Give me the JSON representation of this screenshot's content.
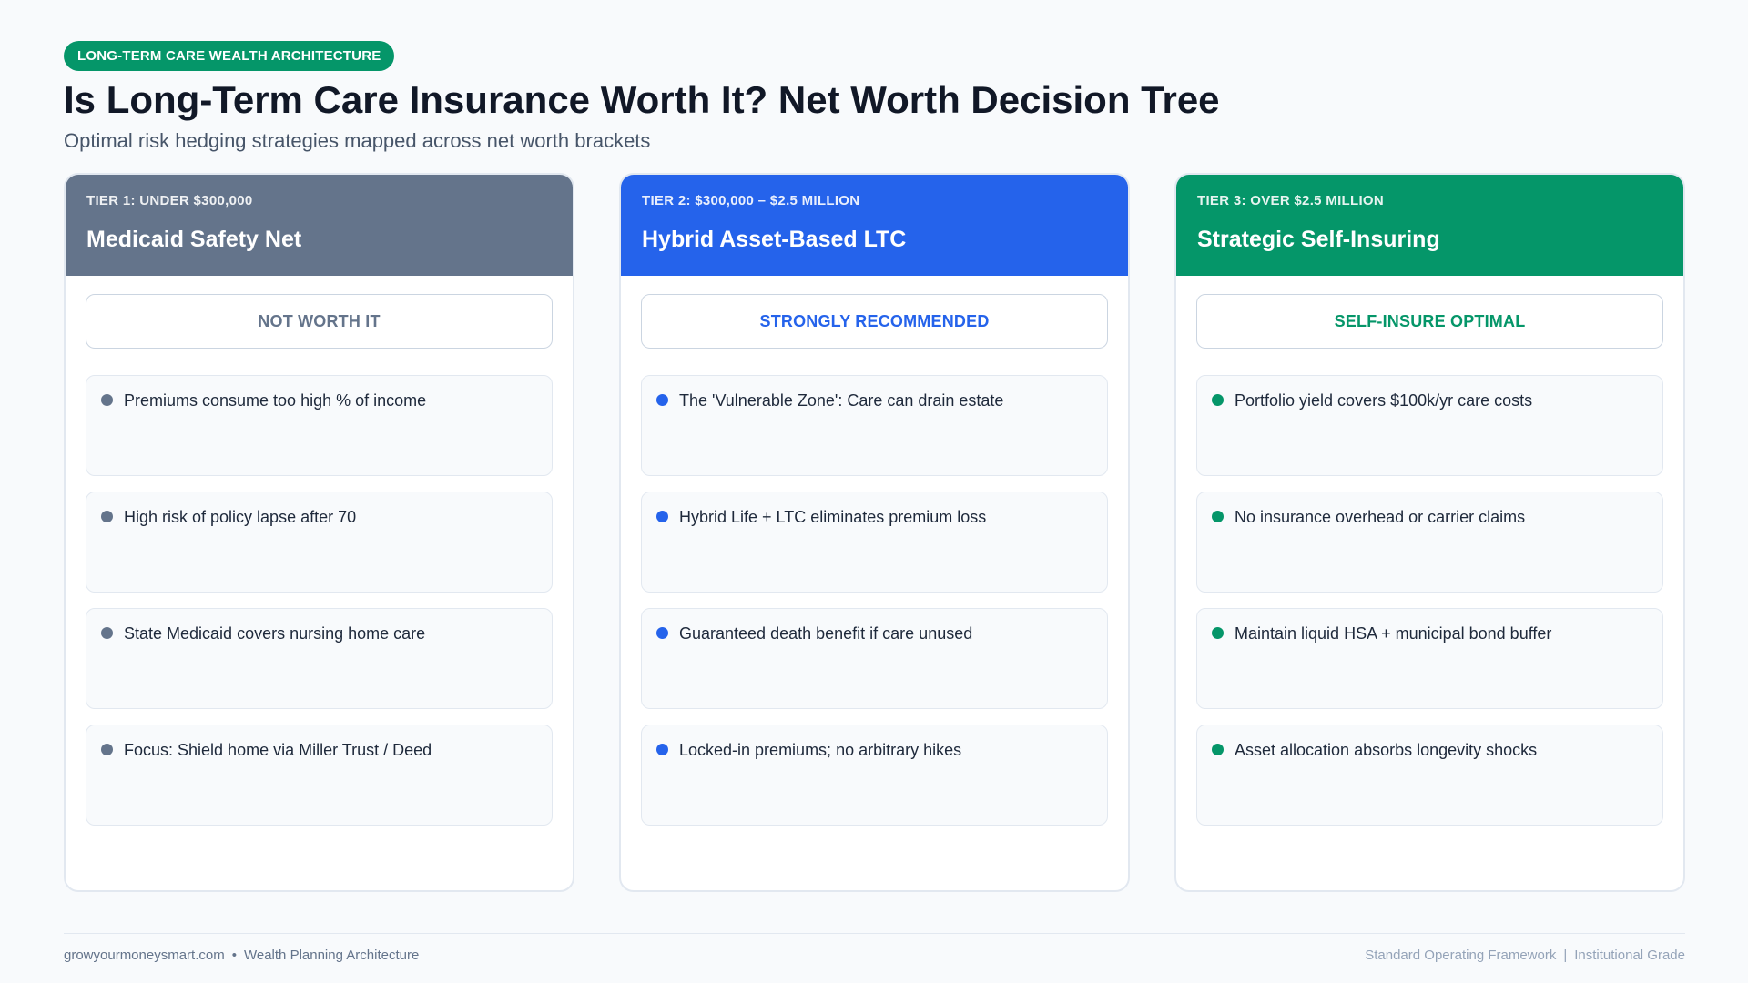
{
  "header": {
    "badge": "LONG-TERM CARE WEALTH ARCHITECTURE",
    "title": "Is Long-Term Care Insurance Worth It? Net Worth Decision Tree",
    "subtitle": "Optimal risk hedging strategies mapped across net worth brackets"
  },
  "colors": {
    "badge": "#059669",
    "tier1": "#64748b",
    "tier2": "#2563eb",
    "tier3": "#059669"
  },
  "tiers": [
    {
      "label": "TIER 1: UNDER $300,000",
      "name": "Medicaid Safety Net",
      "verdict": "NOT WORTH IT",
      "points": [
        "Premiums consume too high % of income",
        "High risk of policy lapse after 70",
        "State Medicaid covers nursing home care",
        "Focus: Shield home via Miller Trust / Deed"
      ]
    },
    {
      "label": "TIER 2: $300,000 – $2.5 MILLION",
      "name": "Hybrid Asset-Based LTC",
      "verdict": "STRONGLY RECOMMENDED",
      "points": [
        "The 'Vulnerable Zone': Care can drain estate",
        "Hybrid Life + LTC eliminates premium loss",
        "Guaranteed death benefit if care unused",
        "Locked-in premiums; no arbitrary hikes"
      ]
    },
    {
      "label": "TIER 3: OVER $2.5 MILLION",
      "name": "Strategic Self-Insuring",
      "verdict": "SELF-INSURE OPTIMAL",
      "points": [
        "Portfolio yield covers $100k/yr care costs",
        "No insurance overhead or carrier claims",
        "Maintain liquid HSA + municipal bond buffer",
        "Asset allocation absorbs longevity shocks"
      ]
    }
  ],
  "footer": {
    "site": "growyourmoneysmart.com",
    "bullet": "•",
    "section": "Wealth Planning Architecture",
    "right_a": "Standard Operating Framework",
    "divider": "|",
    "right_b": "Institutional Grade"
  }
}
